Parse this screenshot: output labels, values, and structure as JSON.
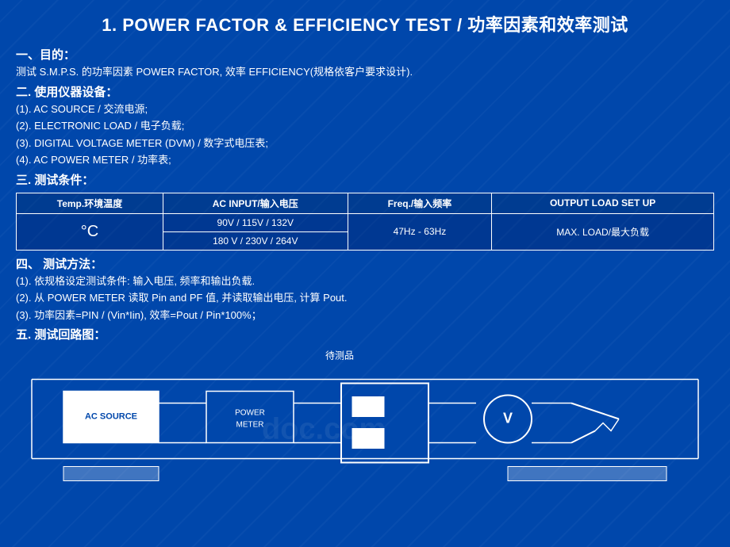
{
  "title": "1.  POWER FACTOR & EFFICIENCY TEST / 功率因素和效率测试",
  "sections": {
    "objective": {
      "heading": "一、目的：",
      "text": "测试 S.M.P.S. 的功率因素 POWER FACTOR, 效率 EFFICIENCY(规格依客户要求设计)."
    },
    "equipment": {
      "heading": "二. 使用仪器设备：",
      "items": [
        "(1). AC SOURCE / 交流电源;",
        "(2). ELECTRONIC LOAD / 电子负载;",
        "(3). DIGITAL VOLTAGE METER (DVM) / 数字式电压表;",
        "(4). AC POWER METER / 功率表;"
      ]
    },
    "conditions": {
      "heading": "三. 测试条件：",
      "table": {
        "headers": [
          "Temp.环境温度",
          "AC INPUT/输入电压",
          "Freq./输入频率",
          "OUTPUT LOAD SET UP"
        ],
        "rows": [
          [
            "°C",
            "90V  / 115V / 132V\n180 V / 230V / 264V",
            "47Hz - 63Hz",
            "MAX. LOAD/最大负载"
          ]
        ]
      }
    },
    "methods": {
      "heading": "四、 测试方法：",
      "items": [
        "(1). 依规格设定测试条件: 输入电压, 频率和输出负载.",
        "(2). 从 POWER METER 读取 Pin and PF 值, 并读取输出电压, 计算 Pout.",
        "(3). 功率因素=PIN / (Vin*Iin), 效率=Pout / Pin*100%；"
      ]
    },
    "circuit": {
      "heading": "五. 测试回路图：",
      "label_dut": "待测品"
    }
  },
  "watermark": "doc.com"
}
